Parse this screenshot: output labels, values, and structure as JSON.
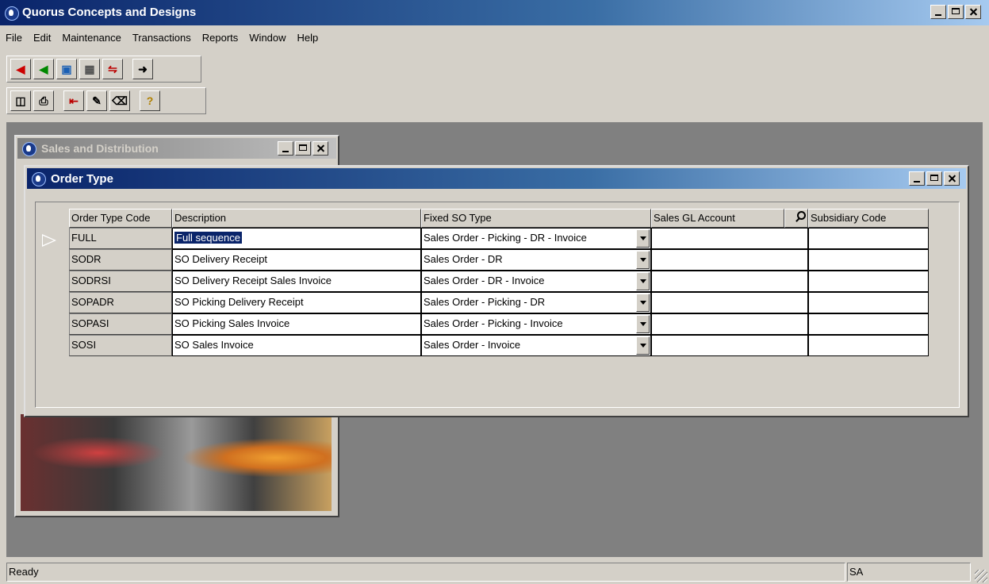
{
  "app": {
    "title": "Quorus Concepts and Designs"
  },
  "menu": [
    "File",
    "Edit",
    "Maintenance",
    "Transactions",
    "Reports",
    "Window",
    "Help"
  ],
  "toolbar1": [
    "back-arrow-icon",
    "back-arrow-icon",
    "module-icon",
    "calendar-grid-icon",
    "transfer-icon",
    "exit-door-icon"
  ],
  "toolbar2": [
    "save-icon",
    "print-icon",
    "import-icon",
    "notes-icon",
    "eraser-icon",
    "help-icon"
  ],
  "child_window": {
    "title": "Sales and Distribution"
  },
  "dialog": {
    "title": "Order Type",
    "columns": [
      "Order Type Code",
      "Description",
      "Fixed SO Type",
      "Sales GL Account",
      "Subsidiary Code"
    ],
    "rows": [
      {
        "code": "FULL",
        "description": "Full sequence",
        "fixed_so_type": "Sales Order - Picking - DR - Invoice",
        "gl": "",
        "sub": ""
      },
      {
        "code": "SODR",
        "description": "SO Delivery Receipt",
        "fixed_so_type": "Sales Order - DR",
        "gl": "",
        "sub": ""
      },
      {
        "code": "SODRSI",
        "description": "SO Delivery Receipt Sales Invoice",
        "fixed_so_type": "Sales Order - DR - Invoice",
        "gl": "",
        "sub": ""
      },
      {
        "code": "SOPADR",
        "description": "SO Picking Delivery Receipt",
        "fixed_so_type": "Sales Order - Picking - DR",
        "gl": "",
        "sub": ""
      },
      {
        "code": "SOPASI",
        "description": "SO Picking Sales Invoice",
        "fixed_so_type": "Sales Order - Picking - Invoice",
        "gl": "",
        "sub": ""
      },
      {
        "code": "SOSI",
        "description": "SO Sales Invoice",
        "fixed_so_type": "Sales Order - Invoice",
        "gl": "",
        "sub": ""
      }
    ]
  },
  "status": {
    "left": "Ready",
    "right": "SA"
  }
}
